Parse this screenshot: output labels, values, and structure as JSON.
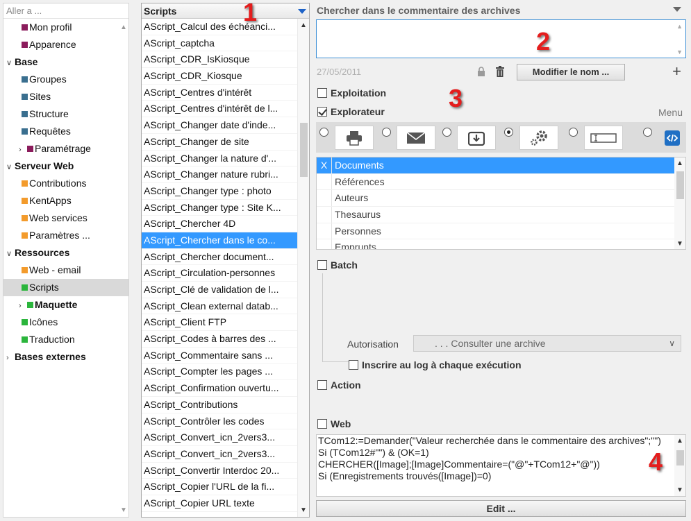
{
  "nav": {
    "header": "Aller a ...",
    "items": [
      {
        "label": "Mon profil",
        "color": "#8b1c5c",
        "kind": "leaf"
      },
      {
        "label": "Apparence",
        "color": "#8b1c5c",
        "kind": "leaf"
      },
      {
        "label": "Base",
        "kind": "group",
        "chev": "∨"
      },
      {
        "label": "Groupes",
        "color": "#3a6f8f",
        "kind": "leaf"
      },
      {
        "label": "Sites",
        "color": "#3a6f8f",
        "kind": "leaf"
      },
      {
        "label": "Structure",
        "color": "#3a6f8f",
        "kind": "leaf"
      },
      {
        "label": "Requêtes",
        "color": "#3a6f8f",
        "kind": "leaf"
      },
      {
        "label": "Paramétrage",
        "color": "#8b1c5c",
        "kind": "sub",
        "chev": "›"
      },
      {
        "label": "Serveur Web",
        "kind": "group",
        "chev": "∨"
      },
      {
        "label": "Contributions",
        "color": "#f39b2c",
        "kind": "leaf"
      },
      {
        "label": "KentApps",
        "color": "#f39b2c",
        "kind": "leaf"
      },
      {
        "label": "Web services",
        "color": "#f39b2c",
        "kind": "leaf"
      },
      {
        "label": "Paramètres ...",
        "color": "#f39b2c",
        "kind": "leaf"
      },
      {
        "label": "Ressources",
        "kind": "group",
        "chev": "∨"
      },
      {
        "label": "Web - email",
        "color": "#f39b2c",
        "kind": "leaf"
      },
      {
        "label": "Scripts",
        "color": "#2bb53c",
        "kind": "leaf",
        "selected": true
      },
      {
        "label": "Maquette",
        "color": "#2bb53c",
        "kind": "subbold",
        "chev": "›"
      },
      {
        "label": "Icônes",
        "color": "#2bb53c",
        "kind": "leaf"
      },
      {
        "label": "Traduction",
        "color": "#2bb53c",
        "kind": "leaf"
      },
      {
        "label": "Bases externes",
        "kind": "group",
        "chev": "›"
      }
    ]
  },
  "scripts": {
    "header": "Scripts",
    "items": [
      "AScript_Calcul des échéanci...",
      "AScript_captcha",
      "AScript_CDR_IsKiosque",
      "AScript_CDR_Kiosque",
      "AScript_Centres d'intérêt",
      "AScript_Centres d'intérêt de l...",
      "AScript_Changer date d'inde...",
      "AScript_Changer de site",
      "AScript_Changer la nature d'...",
      "AScript_Changer nature rubri...",
      "AScript_Changer type : photo",
      "AScript_Changer type : Site K...",
      "AScript_Chercher 4D",
      "AScript_Chercher dans le co...",
      "AScript_Chercher document...",
      "AScript_Circulation-personnes",
      "AScript_Clé de validation de l...",
      "AScript_Clean external datab...",
      "AScript_Client FTP",
      "AScript_Codes à barres des ...",
      "AScript_Commentaire sans ...",
      "AScript_Compter les pages ...",
      "AScript_Confirmation ouvertu...",
      "AScript_Contributions",
      "AScript_Contrôler les codes",
      "AScript_Convert_icn_2vers3...",
      "AScript_Convert_icn_2vers3...",
      "AScript_Convertir Interdoc 20...",
      "AScript_Copier l'URL de la fi...",
      "AScript_Copier URL texte"
    ],
    "selected_index": 13
  },
  "detail": {
    "title": "Chercher dans le commentaire des archives",
    "search_value": "",
    "date": "27/05/2011",
    "rename_label": "Modifier le nom ...",
    "plus": "+",
    "exploitation_label": "Exploitation",
    "explorateur_label": "Explorateur",
    "menu_label": "Menu",
    "icon_options": [
      {
        "icon": "printer-icon",
        "checked": false
      },
      {
        "icon": "mail-icon",
        "checked": false
      },
      {
        "icon": "inbox-download-icon",
        "checked": false
      },
      {
        "icon": "gears-icon",
        "checked": true
      },
      {
        "icon": "text-field-icon",
        "checked": false
      },
      {
        "icon": "code-icon",
        "checked": false
      }
    ],
    "list_items": [
      {
        "label": "Documents",
        "mark": "X",
        "selected": true
      },
      {
        "label": "Références",
        "mark": ""
      },
      {
        "label": "Auteurs",
        "mark": ""
      },
      {
        "label": "Thesaurus",
        "mark": ""
      },
      {
        "label": "Personnes",
        "mark": ""
      },
      {
        "label": "Emprunts",
        "mark": ""
      }
    ],
    "batch_label": "Batch",
    "auth_label": "Autorisation",
    "auth_value": ". . .  Consulter une archive",
    "log_label": "Inscrire au log à chaque exécution",
    "action_label": "Action",
    "web_label": "Web",
    "code_lines": [
      "TCom12:=Demander(\"Valeur recherchée dans le commentaire des archives\";\"\")",
      "Si (TCom12#\"\") & (OK=1)",
      "CHERCHER([Image];[Image]Commentaire=(\"@\"+TCom12+\"@\"))",
      "Si (Enregistrements trouvés([Image])=0)"
    ],
    "edit_label": "Edit ..."
  },
  "markers": [
    "1",
    "2",
    "3",
    "4"
  ],
  "colors": {
    "selection": "#3399ff",
    "focus_border": "#3c8fd6",
    "marker": "#e41d1d"
  }
}
